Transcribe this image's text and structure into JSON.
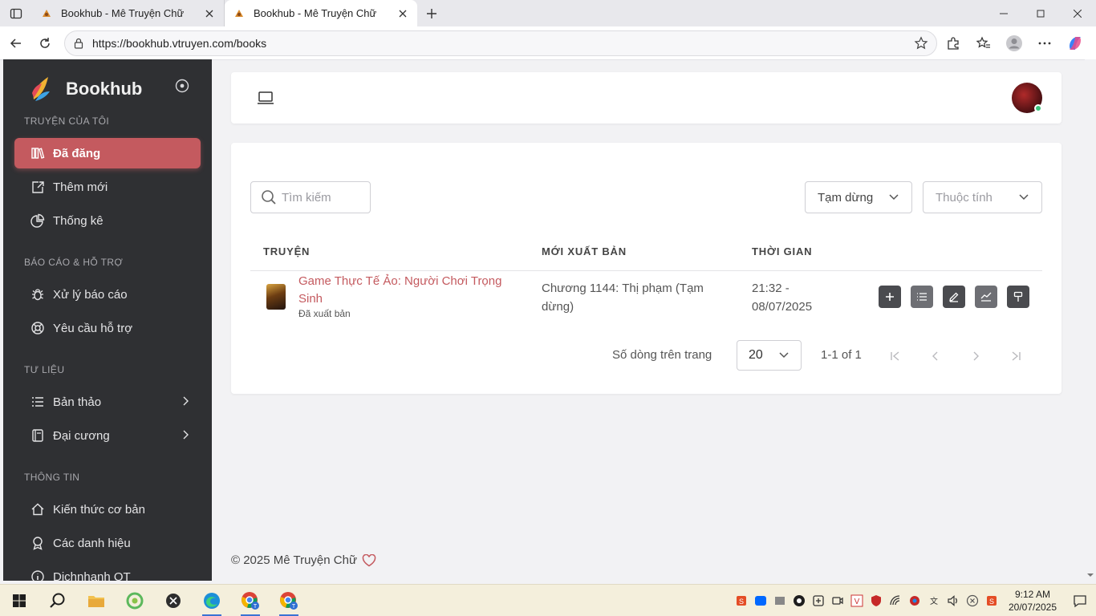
{
  "browser": {
    "tabs": [
      {
        "title": "Bookhub - Mê Truyện Chữ",
        "active": false
      },
      {
        "title": "Bookhub - Mê Truyện Chữ",
        "active": true
      }
    ],
    "url": "https://bookhub.vtruyen.com/books"
  },
  "sidebar": {
    "brand": "Bookhub",
    "sections": [
      {
        "title": "TRUYỆN CỦA TÔI",
        "items": [
          {
            "label": "Đã đăng",
            "icon": "books-icon",
            "active": true
          },
          {
            "label": "Thêm mới",
            "icon": "upload-icon"
          },
          {
            "label": "Thống kê",
            "icon": "pie-chart-icon"
          }
        ]
      },
      {
        "title": "BÁO CÁO & HỖ TRỢ",
        "items": [
          {
            "label": "Xử lý báo cáo",
            "icon": "bug-icon"
          },
          {
            "label": "Yêu cầu hỗ trợ",
            "icon": "lifebuoy-icon"
          }
        ]
      },
      {
        "title": "TƯ LIỆU",
        "items": [
          {
            "label": "Bản thảo",
            "icon": "list-icon",
            "expandable": true
          },
          {
            "label": "Đại cương",
            "icon": "notebook-icon",
            "expandable": true
          }
        ]
      },
      {
        "title": "THÔNG TIN",
        "items": [
          {
            "label": "Kiến thức cơ bản",
            "icon": "home-icon"
          },
          {
            "label": "Các danh hiệu",
            "icon": "award-icon"
          },
          {
            "label": "Dichnhanh QT",
            "icon": "info-icon"
          }
        ]
      }
    ]
  },
  "toolbar": {
    "search_placeholder": "Tìm kiếm",
    "status_filter": "Tạm dừng",
    "attribute_filter": "Thuộc tính"
  },
  "table": {
    "headers": [
      "TRUYỆN",
      "MỚI XUẤT BẢN",
      "THỜI GIAN"
    ],
    "rows": [
      {
        "title": "Game Thực Tế Ảo: Người Chơi Trọng Sinh",
        "status": "Đã xuất bản",
        "latest": "Chương 1144: Thị phạm (Tạm dừng)",
        "time": "21:32 - 08/07/2025"
      }
    ]
  },
  "pagination": {
    "rows_per_page_label": "Số dòng trên trang",
    "rows_per_page": "20",
    "range": "1-1 of 1"
  },
  "footer": {
    "text": "© 2025 Mê Truyện Chữ"
  },
  "taskbar": {
    "time": "9:12 AM",
    "date": "20/07/2025"
  },
  "colors": {
    "accent": "#c45a5f",
    "sidebar_bg": "#2f3033"
  }
}
